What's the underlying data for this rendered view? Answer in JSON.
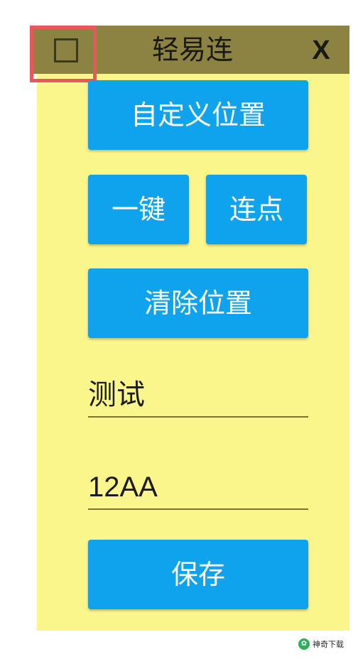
{
  "window": {
    "title": "轻易连",
    "close_label": "X"
  },
  "buttons": {
    "custom_position": "自定义位置",
    "one_key": "一键",
    "continuous_click": "连点",
    "clear_position": "清除位置",
    "save": "保存"
  },
  "fields": {
    "name_value": "测试",
    "code_value": "12AA"
  },
  "watermark": {
    "text": "神奇下载",
    "logo_glyph": "✿"
  },
  "colors": {
    "panel": "#faf68c",
    "titlebar": "#8c8343",
    "button": "#0fa3ee",
    "highlight": "#e8575a"
  }
}
